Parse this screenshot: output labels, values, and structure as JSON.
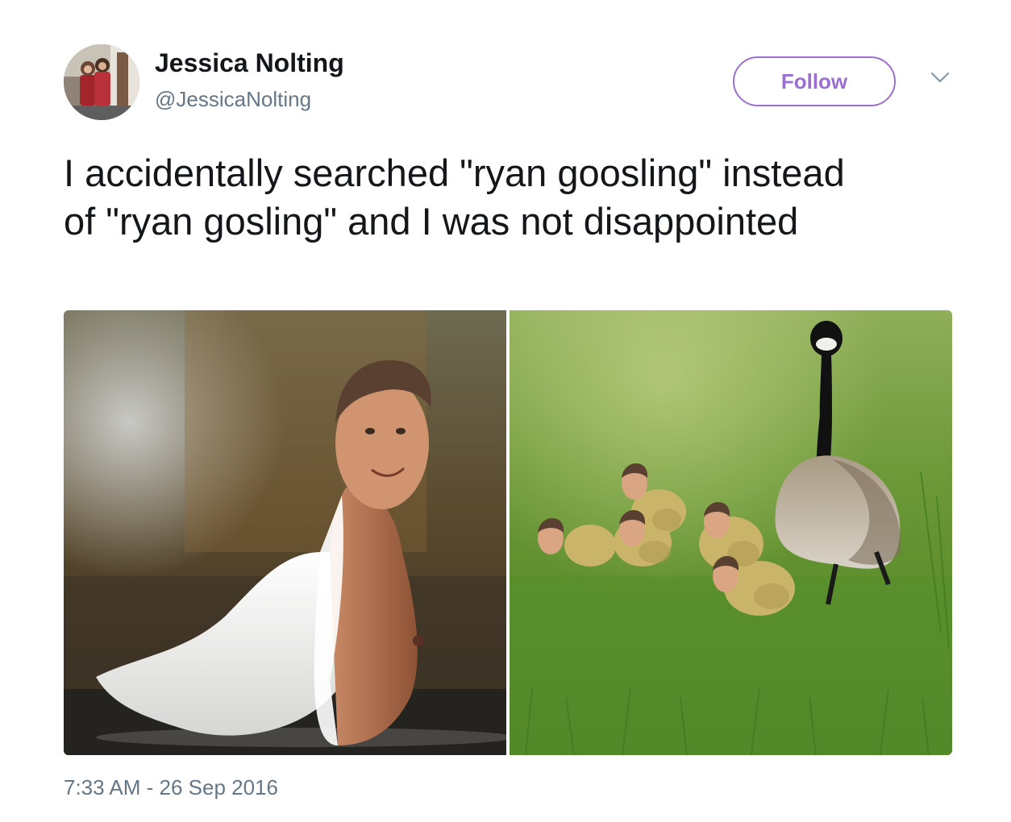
{
  "author": {
    "name": "Jessica Nolting",
    "handle": "@JessicaNolting"
  },
  "follow_label": "Follow",
  "icons": {
    "more": "chevron-down-icon"
  },
  "tweet": {
    "text": "I accidentally searched \"ryan goosling\" instead of \"ryan gosling\" and I was not disappointed",
    "timestamp": "7:33 AM - 26 Sep 2016"
  },
  "colors": {
    "accent": "#9b6ed4",
    "text": "#14171a",
    "secondary": "#657786"
  }
}
